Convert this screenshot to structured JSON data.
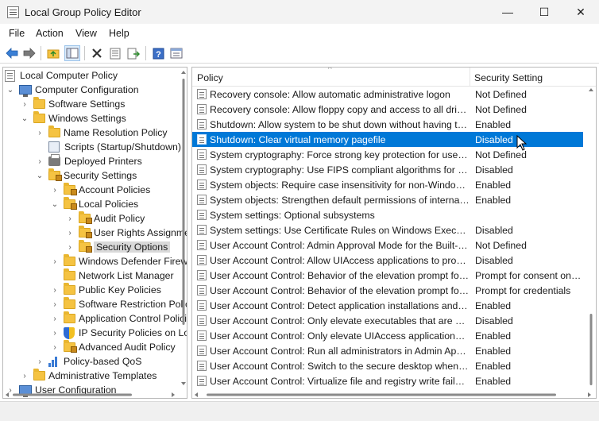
{
  "window": {
    "title": "Local Group Policy Editor",
    "minimize_glyph": "—",
    "maximize_glyph": "☐",
    "close_glyph": "✕"
  },
  "menu": [
    "File",
    "Action",
    "View",
    "Help"
  ],
  "toolbar": {
    "icons": [
      "back-icon",
      "forward-icon",
      "up-folder-icon",
      "show-hide-tree-icon",
      "delete-icon",
      "properties-icon",
      "export-list-icon",
      "help-icon",
      "view-icon"
    ]
  },
  "tree": {
    "items": [
      {
        "label": "Local Computer Policy",
        "level": 0,
        "icon": "doc"
      },
      {
        "label": "Computer Configuration",
        "level": 1,
        "icon": "pc",
        "expander": "⌄"
      },
      {
        "label": "Software Settings",
        "level": 2,
        "icon": "folder",
        "expander": "›"
      },
      {
        "label": "Windows Settings",
        "level": 2,
        "icon": "folder",
        "expander": "⌄"
      },
      {
        "label": "Name Resolution Policy",
        "level": 3,
        "icon": "folder",
        "expander": "›"
      },
      {
        "label": "Scripts (Startup/Shutdown)",
        "level": 3,
        "icon": "scripts",
        "expander": ""
      },
      {
        "label": "Deployed Printers",
        "level": 3,
        "icon": "printer",
        "expander": "›"
      },
      {
        "label": "Security Settings",
        "level": 3,
        "icon": "folder-locked",
        "expander": "⌄"
      },
      {
        "label": "Account Policies",
        "level": 4,
        "icon": "folder-locked",
        "expander": "›"
      },
      {
        "label": "Local Policies",
        "level": 4,
        "icon": "folder-locked",
        "expander": "⌄"
      },
      {
        "label": "Audit Policy",
        "level": 5,
        "icon": "folder-locked",
        "expander": "›"
      },
      {
        "label": "User Rights Assignment",
        "level": 5,
        "icon": "folder-locked",
        "expander": "›"
      },
      {
        "label": "Security Options",
        "level": 5,
        "icon": "folder-locked",
        "expander": "›",
        "selected": true
      },
      {
        "label": "Windows Defender Firewall",
        "level": 4,
        "icon": "folder",
        "expander": "›"
      },
      {
        "label": "Network List Manager",
        "level": 4,
        "icon": "folder",
        "expander": ""
      },
      {
        "label": "Public Key Policies",
        "level": 4,
        "icon": "folder",
        "expander": "›"
      },
      {
        "label": "Software Restriction Policies",
        "level": 4,
        "icon": "folder",
        "expander": "›"
      },
      {
        "label": "Application Control Policies",
        "level": 4,
        "icon": "folder",
        "expander": "›"
      },
      {
        "label": "IP Security Policies on Local Computer",
        "level": 4,
        "icon": "shield",
        "expander": "›"
      },
      {
        "label": "Advanced Audit Policy",
        "level": 4,
        "icon": "folder-locked",
        "expander": "›"
      },
      {
        "label": "Policy-based QoS",
        "level": 3,
        "icon": "chart",
        "expander": "›"
      },
      {
        "label": "Administrative Templates",
        "level": 2,
        "icon": "folder",
        "expander": "›"
      },
      {
        "label": "User Configuration",
        "level": 1,
        "icon": "pc",
        "expander": "›"
      }
    ]
  },
  "list": {
    "header_policy": "Policy",
    "header_setting": "Security Setting",
    "rows": [
      {
        "policy": "Recovery console: Allow automatic administrative logon",
        "setting": "Not Defined"
      },
      {
        "policy": "Recovery console: Allow floppy copy and access to all drives and all folders",
        "setting": "Not Defined"
      },
      {
        "policy": "Shutdown: Allow system to be shut down without having to log on",
        "setting": "Enabled"
      },
      {
        "policy": "Shutdown: Clear virtual memory pagefile",
        "setting": "Disabled",
        "selected": true
      },
      {
        "policy": "System cryptography: Force strong key protection for user keys stored on the computer",
        "setting": "Not Defined"
      },
      {
        "policy": "System cryptography: Use FIPS compliant algorithms for encryption, hashing, and signing",
        "setting": "Disabled"
      },
      {
        "policy": "System objects: Require case insensitivity for non-Windows subsystems",
        "setting": "Enabled"
      },
      {
        "policy": "System objects: Strengthen default permissions of internal system objects",
        "setting": "Enabled"
      },
      {
        "policy": "System settings: Optional subsystems",
        "setting": ""
      },
      {
        "policy": "System settings: Use Certificate Rules on Windows Executables for Software Restriction Policies",
        "setting": "Disabled"
      },
      {
        "policy": "User Account Control: Admin Approval Mode for the Built-in Administrator account",
        "setting": "Not Defined"
      },
      {
        "policy": "User Account Control: Allow UIAccess applications to prompt for elevation without using the secure desktop",
        "setting": "Disabled"
      },
      {
        "policy": "User Account Control: Behavior of the elevation prompt for administrators in Admin Approval Mode",
        "setting": "Prompt for consent on the secure desktop"
      },
      {
        "policy": "User Account Control: Behavior of the elevation prompt for standard users",
        "setting": "Prompt for credentials"
      },
      {
        "policy": "User Account Control: Detect application installations and prompt for elevation",
        "setting": "Enabled"
      },
      {
        "policy": "User Account Control: Only elevate executables that are signed and validated",
        "setting": "Disabled"
      },
      {
        "policy": "User Account Control: Only elevate UIAccess applications that are installed in secure locations",
        "setting": "Enabled"
      },
      {
        "policy": "User Account Control: Run all administrators in Admin Approval Mode",
        "setting": "Enabled"
      },
      {
        "policy": "User Account Control: Switch to the secure desktop when prompting for elevation",
        "setting": "Enabled"
      },
      {
        "policy": "User Account Control: Virtualize file and registry write failures to per-user locations",
        "setting": "Enabled"
      }
    ]
  },
  "colors": {
    "selection": "#0078d7",
    "tree_selection": "#d9d9d9",
    "titlebar": "#f3f3f3"
  }
}
